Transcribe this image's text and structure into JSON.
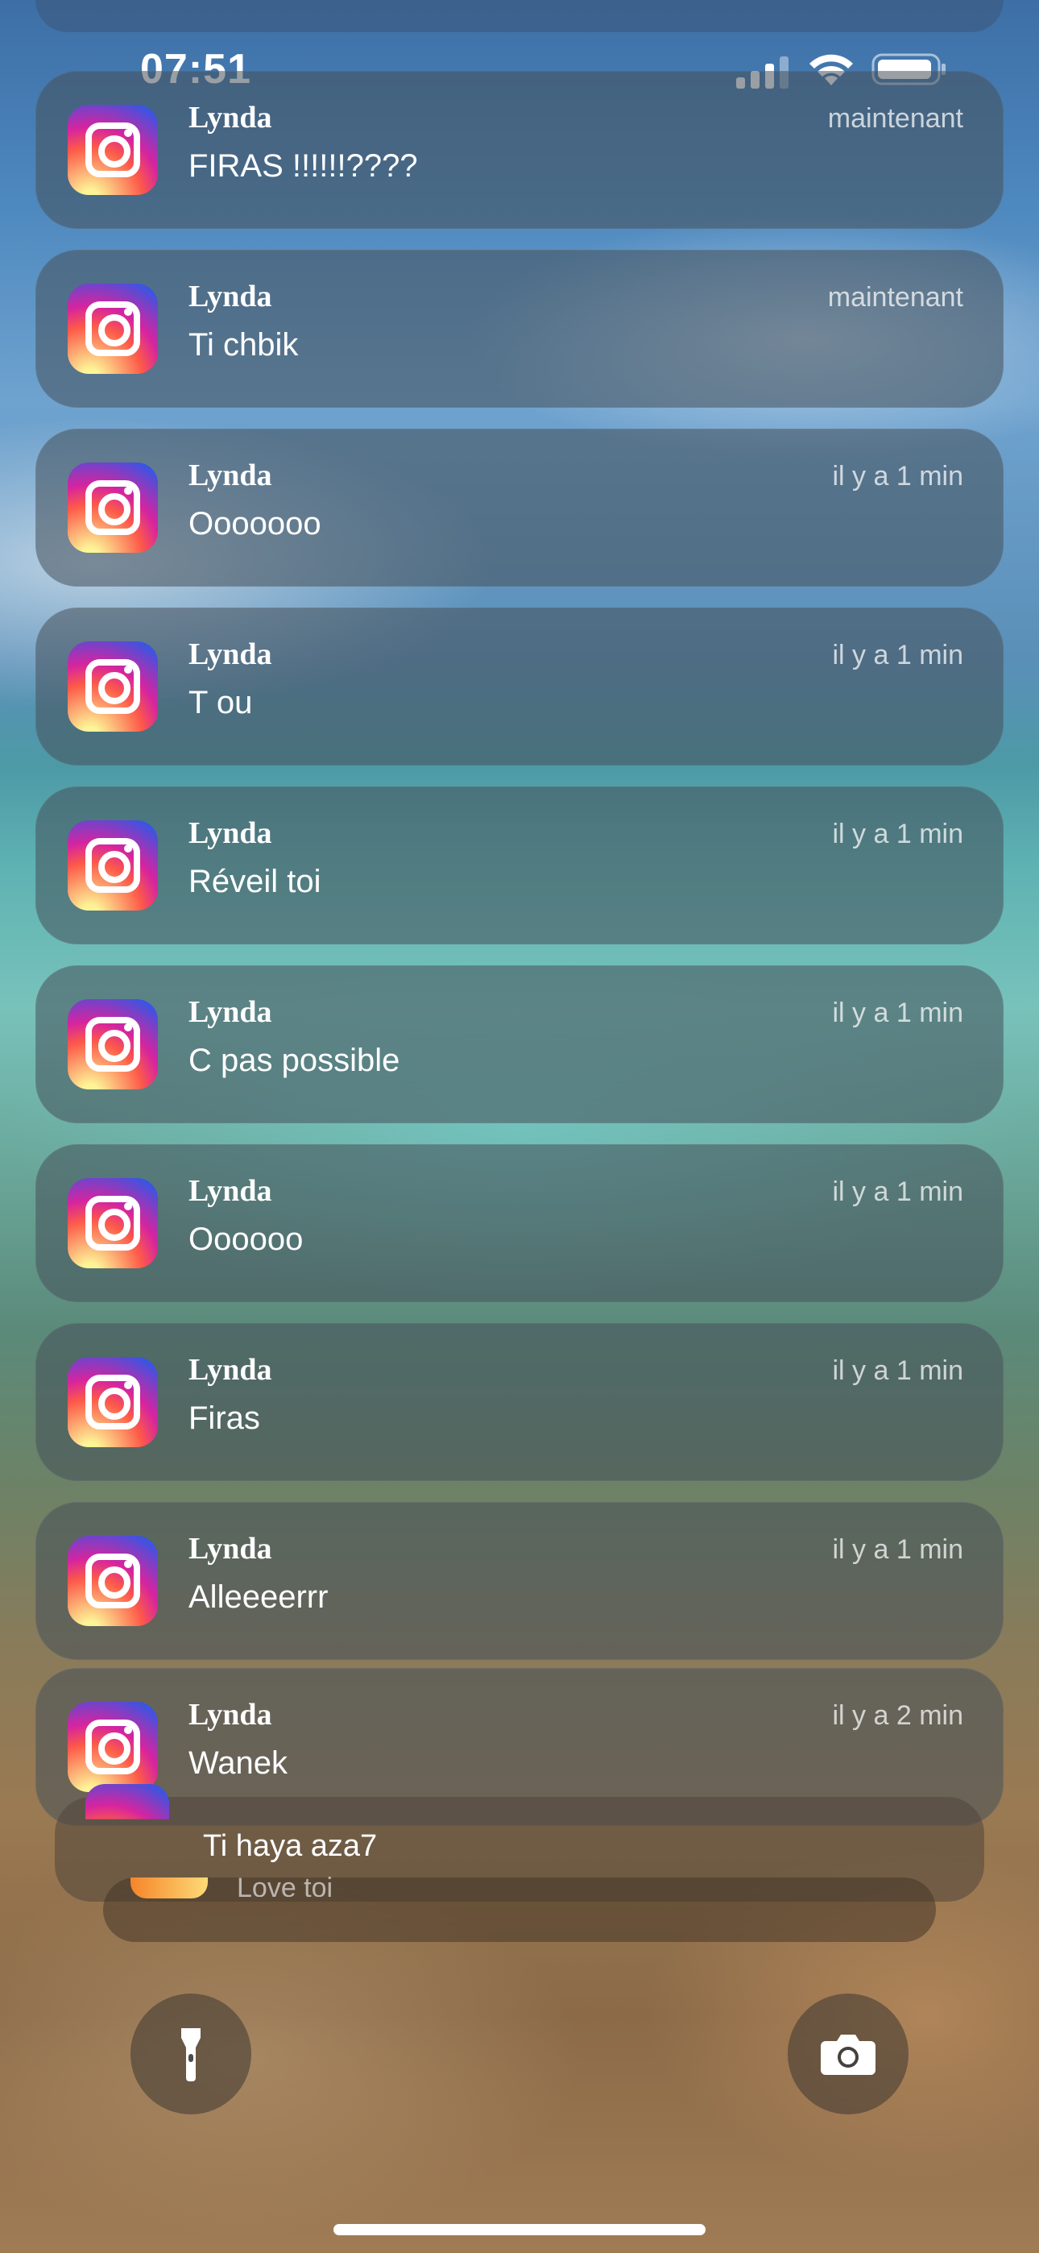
{
  "status_bar": {
    "time": "07:51",
    "signal_icon": "cellular-signal-icon",
    "wifi_icon": "wifi-icon",
    "battery_icon": "battery-icon"
  },
  "notifications": [
    {
      "app_icon": "instagram-icon",
      "sender": "Lynda",
      "message": "FIRAS !!!!!!????",
      "time": "maintenant"
    },
    {
      "app_icon": "instagram-icon",
      "sender": "Lynda",
      "message": "Ti chbik",
      "time": "maintenant"
    },
    {
      "app_icon": "instagram-icon",
      "sender": "Lynda",
      "message": "Ooooooo",
      "time": "il y a 1 min"
    },
    {
      "app_icon": "instagram-icon",
      "sender": "Lynda",
      "message": "T ou",
      "time": "il y a 1 min"
    },
    {
      "app_icon": "instagram-icon",
      "sender": "Lynda",
      "message": "Réveil toi",
      "time": "il y a 1 min"
    },
    {
      "app_icon": "instagram-icon",
      "sender": "Lynda",
      "message": "C pas possible",
      "time": "il y a 1 min"
    },
    {
      "app_icon": "instagram-icon",
      "sender": "Lynda",
      "message": "Oooooo",
      "time": "il y a 1 min"
    },
    {
      "app_icon": "instagram-icon",
      "sender": "Lynda",
      "message": "Firas",
      "time": "il y a 1 min"
    },
    {
      "app_icon": "instagram-icon",
      "sender": "Lynda",
      "message": "Alleeeerrr",
      "time": "il y a 1 min"
    },
    {
      "app_icon": "instagram-icon",
      "sender": "Lynda",
      "message": "Wanek",
      "time": "il y a 2 min"
    }
  ],
  "stacked": {
    "first_message": "Ti haya aza7",
    "second_message": "Love toi"
  },
  "quick_actions": {
    "left": "flashlight-icon",
    "right": "camera-icon"
  }
}
